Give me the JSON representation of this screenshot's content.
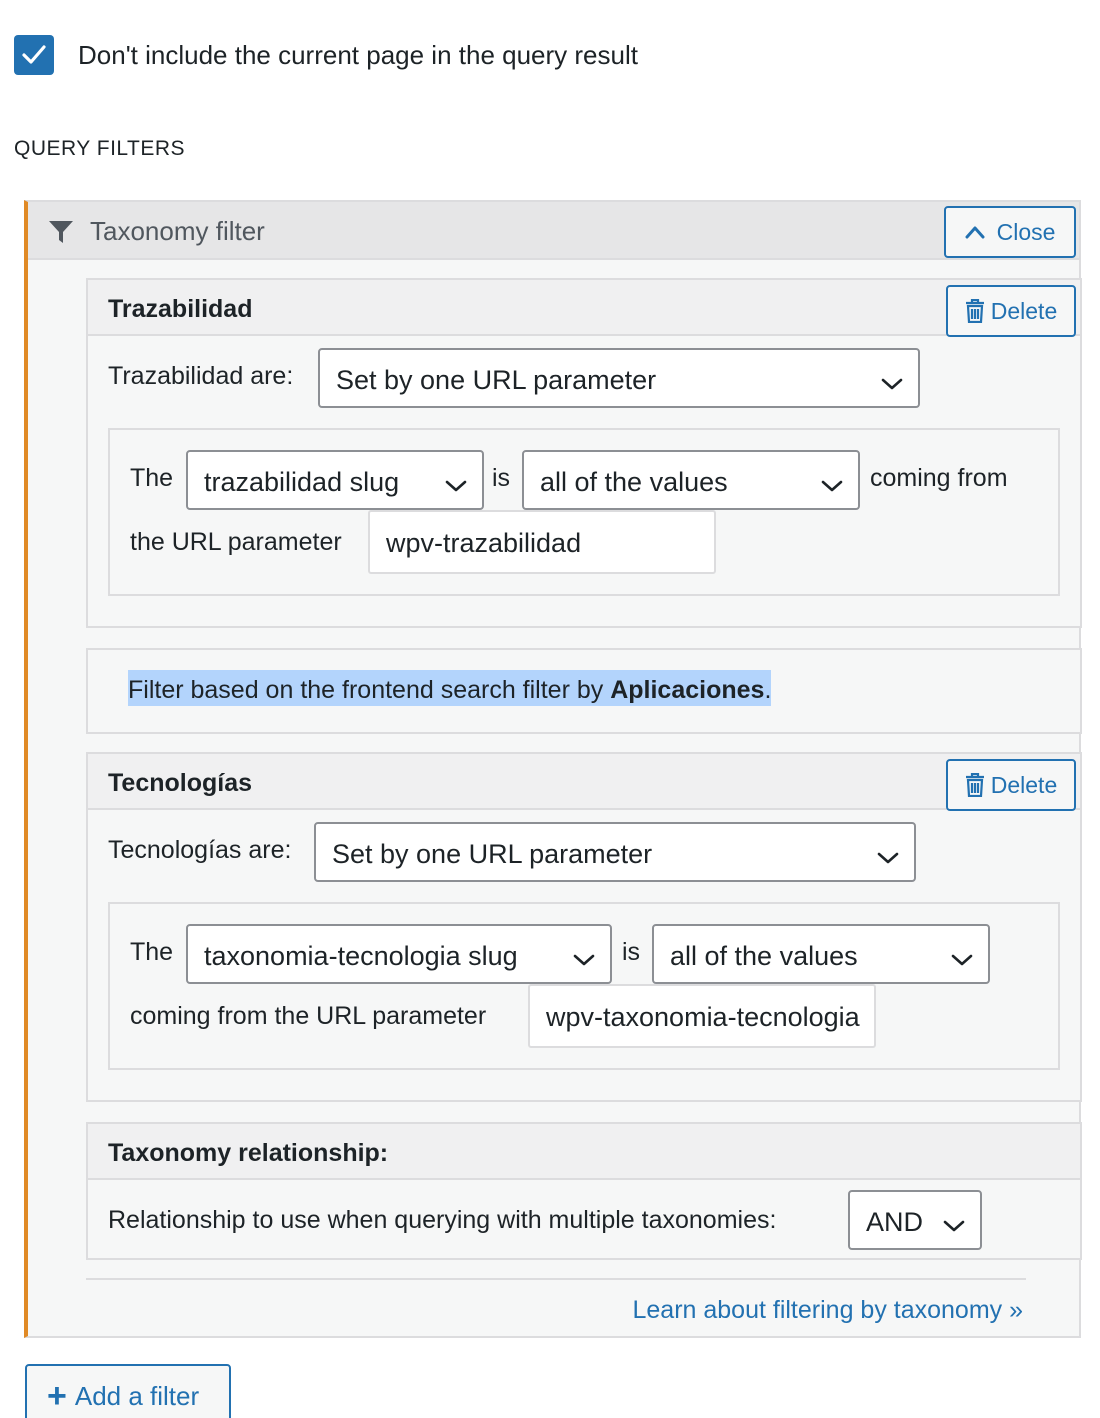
{
  "exclude_current": {
    "label": "Don't include the current page in the query result",
    "checked": true
  },
  "section_title": "QUERY FILTERS",
  "taxonomy_filter": {
    "title": "Taxonomy filter",
    "close_label": "Close",
    "filters": [
      {
        "title": "Trazabilidad",
        "delete_label": "Delete",
        "are_label": "Trazabilidad are:",
        "mode": "Set by one URL parameter",
        "the_label": "The",
        "field": "trazabilidad slug",
        "is_label": "is",
        "operator": "all of the values",
        "coming_from": "coming from",
        "url_param_label": "the URL parameter",
        "url_param": "wpv-trazabilidad"
      },
      {
        "title": "Tecnologías",
        "delete_label": "Delete",
        "are_label": "Tecnologías are:",
        "mode": "Set by one URL parameter",
        "the_label": "The",
        "field": "taxonomia-tecnologia slug",
        "is_label": "is",
        "operator": "all of the values",
        "url_param_label": "coming from the URL parameter",
        "url_param": "wpv-taxonomia-tecnologia"
      }
    ],
    "info": {
      "prefix": "Filter based on the frontend search filter by ",
      "bold": "Aplicaciones",
      "suffix": "."
    },
    "relationship": {
      "title": "Taxonomy relationship:",
      "label": "Relationship to use when querying with multiple taxonomies:",
      "value": "AND"
    },
    "learn_link": "Learn about filtering by taxonomy »"
  },
  "add_filter_label": "Add a filter",
  "colors": {
    "accent": "#2271b1",
    "left_border": "#e08a26",
    "highlight": "#b3d4fc"
  }
}
